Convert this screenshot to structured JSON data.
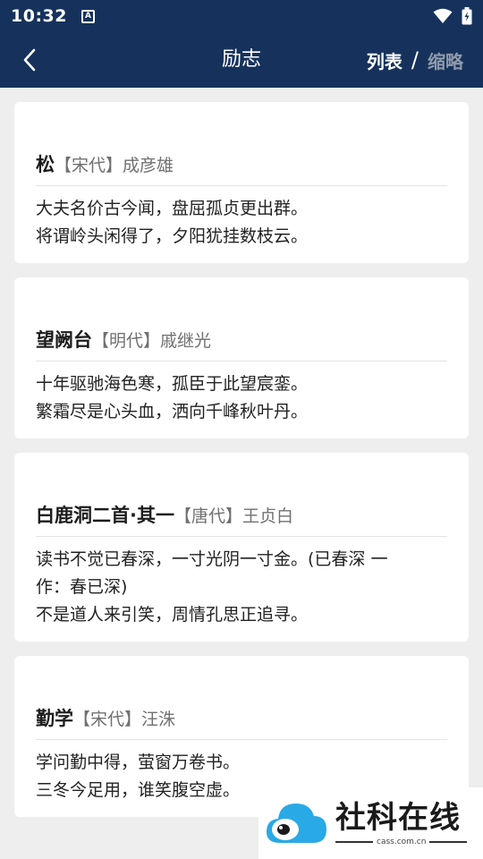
{
  "status_bar": {
    "time": "10:32",
    "notification_badge": "A"
  },
  "app_bar": {
    "title": "励志",
    "view_list": "列表",
    "separator": "/",
    "view_thumbnail": "缩略"
  },
  "poems": [
    {
      "title": "松",
      "dynasty": "【宋代】",
      "author": "成彦雄",
      "lines": [
        "大夫名价古今闻，盘屈孤贞更出群。",
        "将谓岭头闲得了，夕阳犹挂数枝云。"
      ]
    },
    {
      "title": "望阙台",
      "dynasty": "【明代】",
      "author": "戚继光",
      "lines": [
        "十年驱驰海色寒，孤臣于此望宸銮。",
        "繁霜尽是心头血，洒向千峰秋叶丹。"
      ]
    },
    {
      "title": "白鹿洞二首·其一",
      "dynasty": "【唐代】",
      "author": "王贞白",
      "lines": [
        "读书不觉已春深，一寸光阴一寸金。(已春深 一",
        "作：春已深)",
        "不是道人来引笑，周情孔思正追寻。"
      ]
    },
    {
      "title": "勤学",
      "dynasty": "【宋代】",
      "author": "汪洙",
      "lines": [
        "学问勤中得，萤窗万卷书。",
        "三冬今足用，谁笑腹空虚。"
      ]
    }
  ],
  "watermark": {
    "name": "社科在线",
    "domain": "cass.com.cn"
  },
  "colors": {
    "header": "#16325c",
    "background": "#eeeeee",
    "muted_toggle": "#8f9aab",
    "logo_blue": "#29a9e6"
  }
}
